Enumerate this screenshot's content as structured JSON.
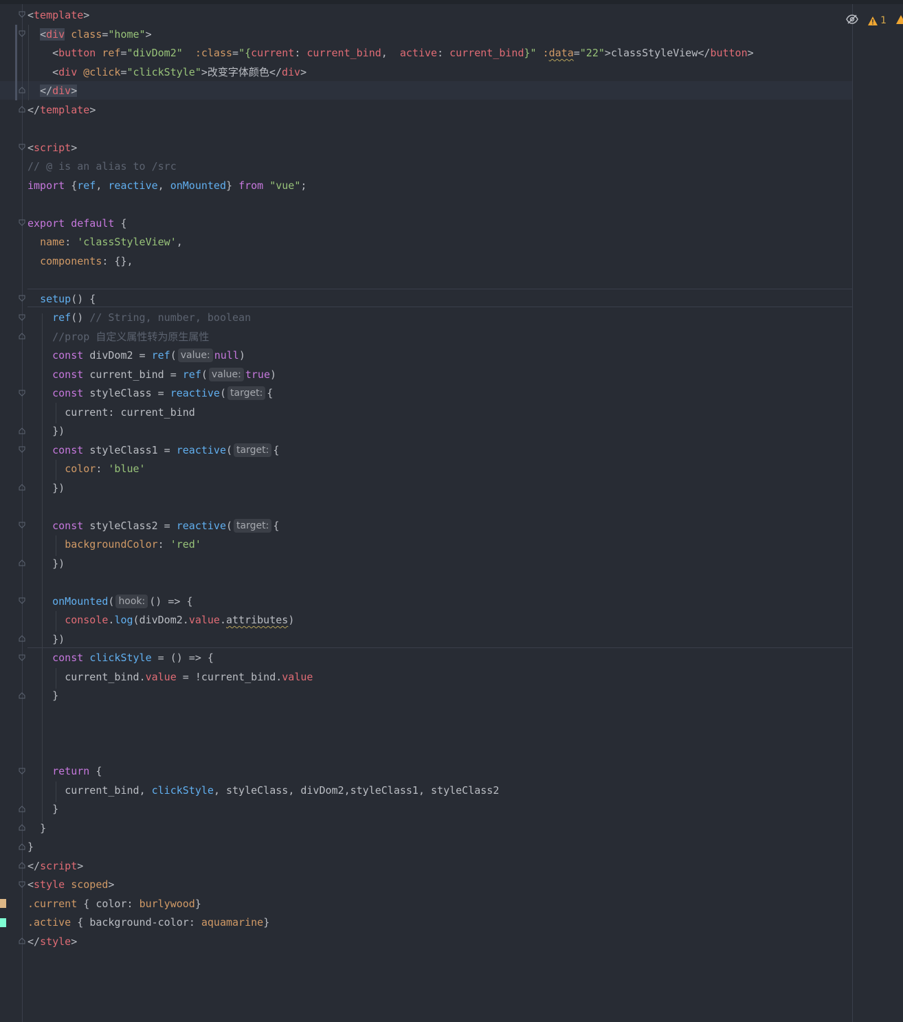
{
  "editor": {
    "warnings_count": "1",
    "swatch_colors": {
      "burlywood": "#deb887",
      "aquamarine": "#7fffd4"
    }
  },
  "code": {
    "l1": "template",
    "l2_div": "div",
    "l2_attr": "class",
    "l2_val": "\"home\"",
    "l3_tag": "button",
    "l3_ref_attr": "ref",
    "l3_ref_val": "\"divDom2\"",
    "l3_class_attr": ":class",
    "l3_q1": "\"{",
    "l3_current": "current",
    "l3_colon1": ": ",
    "l3_bind1": "current_bind",
    "l3_comma": ",  ",
    "l3_active": "active",
    "l3_colon2": ": ",
    "l3_bind2": "current_bind",
    "l3_q2": "}\"",
    "l3_data_colon": ":",
    "l3_data": "data",
    "l3_data_val": "\"22\"",
    "l3_text": "classStyleView",
    "l3_close": "button",
    "l4_tag": "div",
    "l4_attr": "@click",
    "l4_val": "\"clickStyle\"",
    "l4_text": "改变字体颜色",
    "l4_close": "div",
    "l5_close": "div",
    "l6_close": "template",
    "l8": "script",
    "l9": "// @ is an alias to /src",
    "l10_import": "import",
    "l10_ref": "ref",
    "l10_reactive": "reactive",
    "l10_onMounted": "onMounted",
    "l10_from": "from",
    "l10_vue": "\"vue\"",
    "l12_export": "export",
    "l12_default": "default",
    "l13_name": "name",
    "l13_val": "'classStyleView'",
    "l14_components": "components",
    "l16_setup": "setup",
    "l17_ref": "ref",
    "l17_cmt": "// String, number, boolean",
    "l18_cmt": "//prop 自定义属性转为原生属性",
    "const": "const",
    "l19_var": "divDom2",
    "l19_fn": "ref",
    "hint_value": "value:",
    "l19_null": "null",
    "l20_var": "current_bind",
    "l20_fn": "ref",
    "l20_true": "true",
    "l21_var": "styleClass",
    "l21_fn": "reactive",
    "hint_target": "target:",
    "l22_key": "current",
    "l22_val": "current_bind",
    "l24_var": "styleClass1",
    "l24_fn": "reactive",
    "l25_key": "color",
    "l25_val": "'blue'",
    "l28_var": "styleClass2",
    "l28_fn": "reactive",
    "l29_key": "backgroundColor",
    "l29_val": "'red'",
    "l32_fn": "onMounted",
    "hint_hook": "hook:",
    "l33_console": "console",
    "l33_log": "log",
    "l33_obj": "divDom2",
    "l33_value": "value",
    "l33_attrs": "attributes",
    "l35_var": "clickStyle",
    "l36_obj": "current_bind",
    "l36_value": "value",
    "l36_obj2": "!current_bind",
    "l36_value2": "value",
    "l41_return": "return",
    "l42_a": "current_bind",
    "l42_b": "clickStyle",
    "l42_c": "styleClass",
    "l42_d": "divDom2",
    "l42_e": "styleClass1",
    "l42_f": "styleClass2",
    "l46_close": "script",
    "l47_tag": "style",
    "l47_attr": "scoped",
    "l48_sel": ".current",
    "l48_prop": "color",
    "l48_val": "burlywood",
    "l49_sel": ".active",
    "l49_prop": "background-color",
    "l49_val": "aquamarine",
    "l50_close": "style"
  }
}
